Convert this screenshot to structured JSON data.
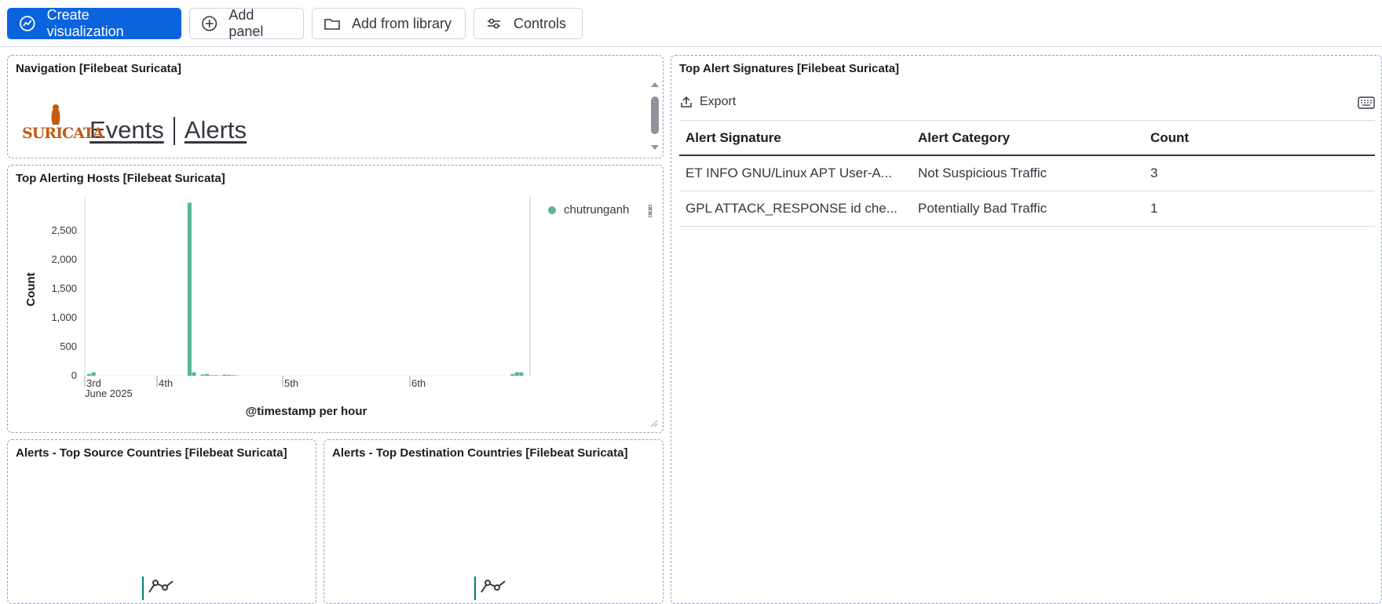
{
  "toolbar": {
    "create_visualization": "Create visualization",
    "add_panel": "Add panel",
    "add_from_library": "Add from library",
    "controls": "Controls"
  },
  "navigation_panel": {
    "title": "Navigation [Filebeat Suricata]",
    "logo_text": "SURICATA",
    "links": [
      "Events",
      "Alerts"
    ]
  },
  "hosts_panel": {
    "title": "Top Alerting Hosts [Filebeat Suricata]",
    "legend": [
      "chutrunganh"
    ],
    "colors": {
      "series": "#54b399"
    }
  },
  "signatures_panel": {
    "title": "Top Alert Signatures [Filebeat Suricata]",
    "export_label": "Export",
    "columns": [
      "Alert Signature",
      "Alert Category",
      "Count"
    ],
    "rows": [
      [
        "ET INFO GNU/Linux APT User-A...",
        "Not Suspicious Traffic",
        "3"
      ],
      [
        "GPL ATTACK_RESPONSE id che...",
        "Potentially Bad Traffic",
        "1"
      ]
    ]
  },
  "source_countries_panel": {
    "title": "Alerts - Top Source Countries [Filebeat Suricata]"
  },
  "destination_countries_panel": {
    "title": "Alerts - Top Destination Countries [Filebeat Suricata]"
  },
  "chart_data": {
    "type": "bar",
    "xlabel": "@timestamp per hour",
    "ylabel": "Count",
    "x_ticks": [
      "3rd",
      "4th",
      "5th",
      "6th"
    ],
    "x_sub_label": "June 2025",
    "y_ticks": [
      "0",
      "500",
      "1,000",
      "1,500",
      "2,000",
      "2,500"
    ],
    "ylim": [
      0,
      3000
    ],
    "series": [
      {
        "name": "chutrunganh",
        "x_hours": [
          1,
          2,
          24,
          25,
          27,
          28,
          29,
          30,
          31,
          32,
          33,
          34,
          35,
          98,
          99,
          100
        ],
        "values": [
          30,
          60,
          2980,
          60,
          20,
          30,
          10,
          10,
          5,
          20,
          15,
          10,
          5,
          30,
          60,
          60
        ]
      }
    ],
    "x_hour_range": [
      0,
      102
    ]
  }
}
